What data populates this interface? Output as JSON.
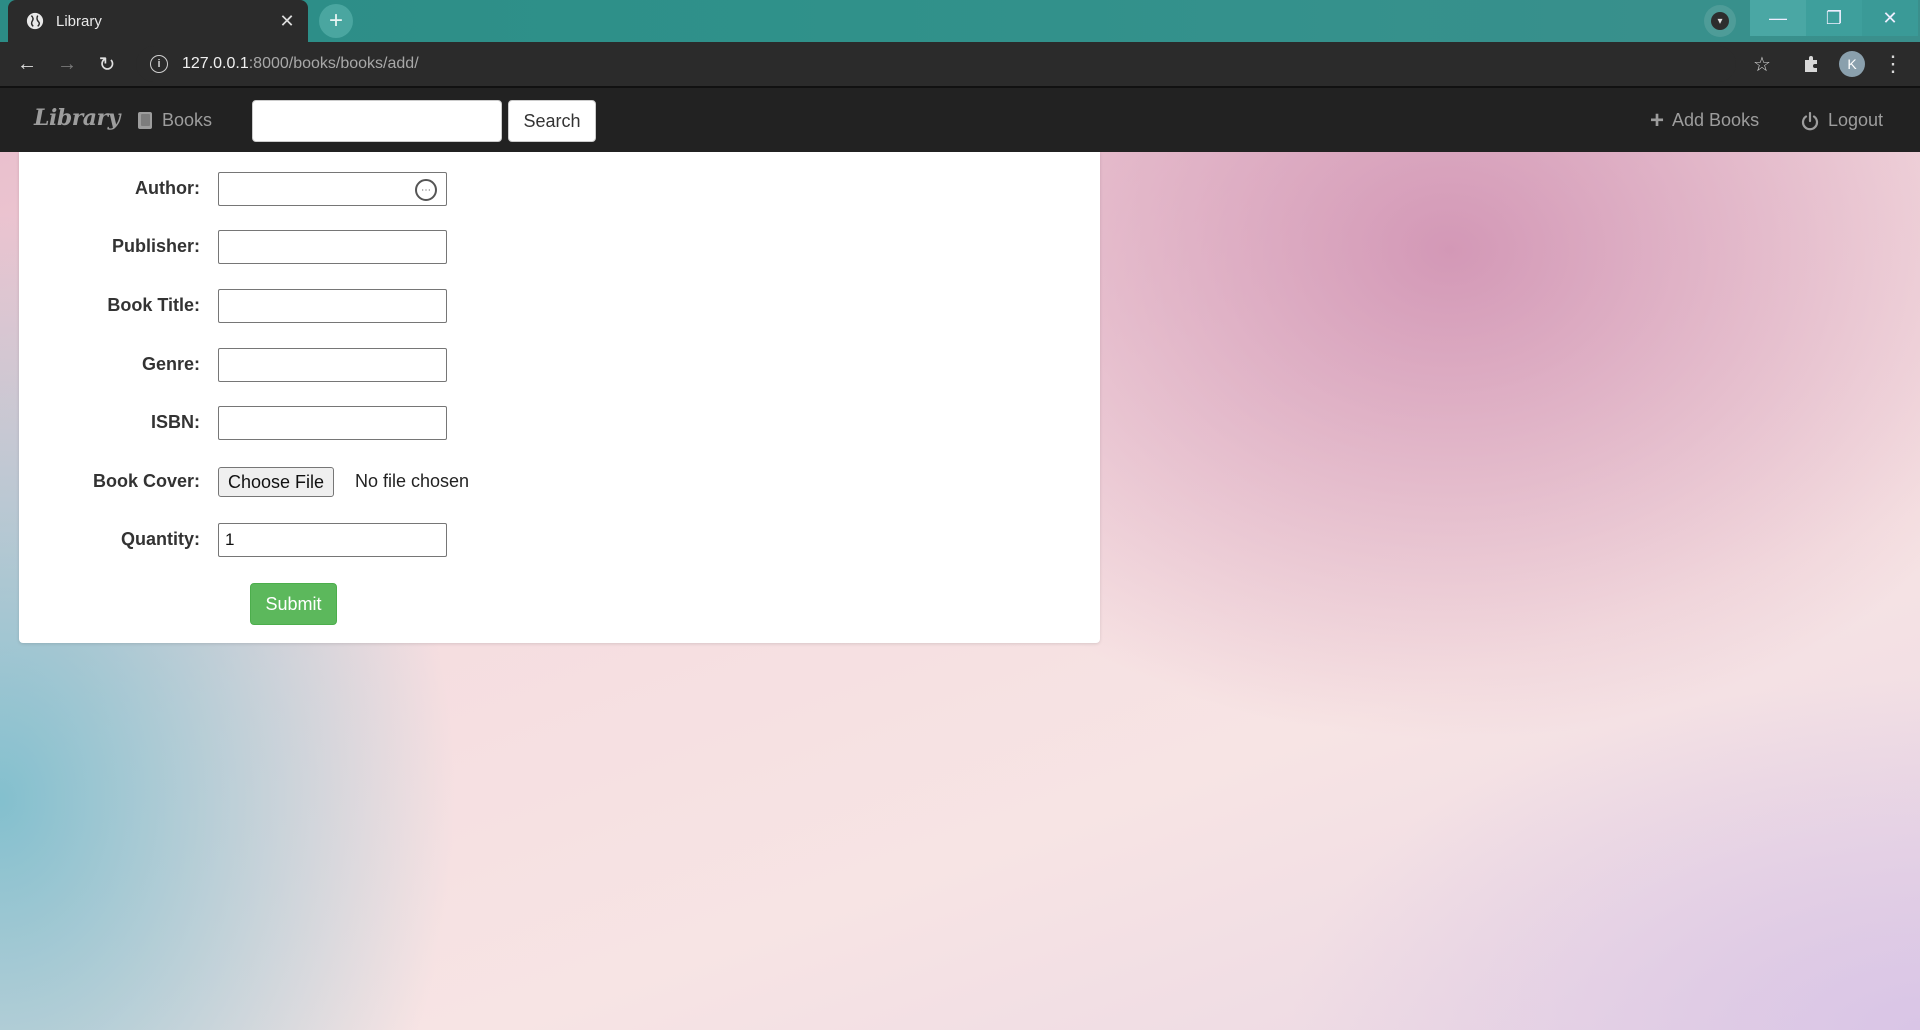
{
  "browser": {
    "tab_title": "Library",
    "url_host": "127.0.0.1",
    "url_path": ":8000/books/books/add/",
    "profile_initial": "K"
  },
  "navbar": {
    "brand": "Library",
    "books_label": "Books",
    "search_value": "",
    "search_button": "Search",
    "add_books_label": "Add Books",
    "logout_label": "Logout"
  },
  "form": {
    "fields": [
      {
        "label": "Author:",
        "value": ""
      },
      {
        "label": "Publisher:",
        "value": ""
      },
      {
        "label": "Book Title:",
        "value": ""
      },
      {
        "label": "Genre:",
        "value": ""
      },
      {
        "label": "ISBN:",
        "value": ""
      },
      {
        "label": "Quantity:",
        "value": "1"
      }
    ],
    "book_cover_label": "Book Cover:",
    "file_button": "Choose File",
    "file_status": "No file chosen",
    "submit_label": "Submit"
  },
  "colors": {
    "navbar_bg": "#222222",
    "submit_bg": "#5cb85c",
    "tabstrip_bg": "#2f918a"
  }
}
